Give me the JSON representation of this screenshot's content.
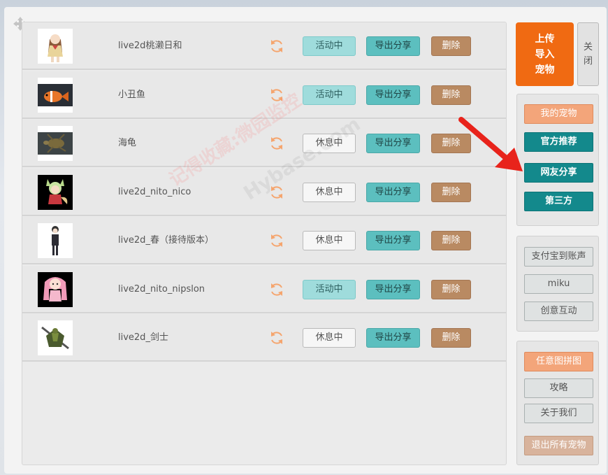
{
  "window": {
    "upload_label_lines": [
      "上传",
      "导入",
      "宠物"
    ],
    "close_label_lines": [
      "关",
      "闭"
    ]
  },
  "pets": [
    {
      "name": "live2d桃濑日和",
      "status": "活动中",
      "active": true,
      "thumb": "anime-girl-school-uniform"
    },
    {
      "name": "小丑鱼",
      "status": "活动中",
      "active": true,
      "thumb": "clownfish"
    },
    {
      "name": "海龟",
      "status": "休息中",
      "active": false,
      "thumb": "sea-turtle"
    },
    {
      "name": "live2d_nito_nico",
      "status": "休息中",
      "active": false,
      "thumb": "fox-eared-girl"
    },
    {
      "name": "live2d_春（接待版本）",
      "status": "休息中",
      "active": false,
      "thumb": "girl-in-dark-suit"
    },
    {
      "name": "live2d_nito_nipslon",
      "status": "活动中",
      "active": true,
      "thumb": "pink-haired-girl"
    },
    {
      "name": "live2d_剑士",
      "status": "休息中",
      "active": false,
      "thumb": "armored-swordsman"
    }
  ],
  "row_actions": {
    "export_label": "导出分享",
    "delete_label": "删除"
  },
  "nav_group": [
    {
      "label": "我的宠物",
      "style": "orange"
    },
    {
      "label": "官方推荐",
      "style": "teal"
    },
    {
      "label": "网友分享",
      "style": "teal"
    },
    {
      "label": "第三方",
      "style": "teal"
    }
  ],
  "extra_group": [
    {
      "label": "支付宝到账声"
    },
    {
      "label": "miku"
    },
    {
      "label": "创意互动"
    }
  ],
  "misc_group": [
    {
      "label": "任意图拼图",
      "style": "orange"
    },
    {
      "label": "攻略",
      "style": "gray"
    },
    {
      "label": "关于我们",
      "style": "gray"
    },
    {
      "label": "退出所有宠物",
      "style": "brown"
    }
  ],
  "watermark": {
    "line1": "记得收藏:微园监控",
    "line2": "Hybase.com"
  },
  "colors": {
    "accent_orange": "#f06a12",
    "teal": "#13898c",
    "active_status": "#9fdcdc",
    "export": "#5cbfbf",
    "delete": "#b98a62",
    "annotation_arrow": "#e8231b"
  }
}
